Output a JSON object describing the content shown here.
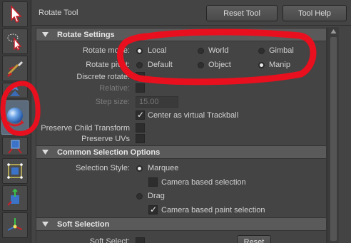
{
  "header": {
    "title": "Rotate Tool",
    "reset_label": "Reset Tool",
    "help_label": "Tool Help"
  },
  "toolbar": {
    "tools": [
      {
        "name": "select-tool-icon"
      },
      {
        "name": "lasso-select-tool-icon"
      },
      {
        "name": "paint-select-tool-icon"
      },
      {
        "name": "move-tool-icon"
      },
      {
        "name": "rotate-tool-icon",
        "active": true
      },
      {
        "name": "scale-tool-icon"
      },
      {
        "name": "universal-manipulator-icon"
      },
      {
        "name": "soft-modification-icon"
      },
      {
        "name": "show-manipulator-icon"
      }
    ]
  },
  "rotate_settings": {
    "title": "Rotate Settings",
    "rotate_mode_label": "Rotate mode:",
    "rotate_mode_options": [
      "Local",
      "World",
      "Gimbal"
    ],
    "rotate_mode_selected": "Local",
    "rotate_pivot_label": "Rotate pivot:",
    "rotate_pivot_options": [
      "Default",
      "Object",
      "Manip"
    ],
    "rotate_pivot_selected": "Manip",
    "discrete_rotate_label": "Discrete rotate:",
    "relative_label": "Relative:",
    "step_size_label": "Step size:",
    "step_size_value": "15.00",
    "trackball_label": "Center as virtual Trackball",
    "preserve_child_label": "Preserve Child Transform",
    "preserve_uvs_label": "Preserve UVs"
  },
  "common_selection": {
    "title": "Common Selection Options",
    "selection_style_label": "Selection Style:",
    "marquee_label": "Marquee",
    "camera_based_selection_label": "Camera based selection",
    "drag_label": "Drag",
    "camera_based_paint_label": "Camera based paint selection"
  },
  "soft_selection": {
    "title": "Soft Selection",
    "soft_select_label": "Soft Select:",
    "reset_label": "Reset"
  },
  "colors": {
    "annotation": "#e8101e",
    "panel": "#444444",
    "section_header": "#5a5a5a"
  }
}
